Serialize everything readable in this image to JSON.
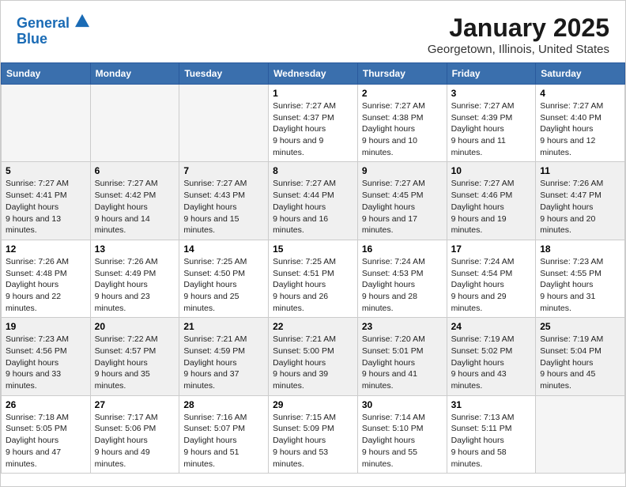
{
  "logo": {
    "line1": "General",
    "line2": "Blue"
  },
  "title": "January 2025",
  "location": "Georgetown, Illinois, United States",
  "weekdays": [
    "Sunday",
    "Monday",
    "Tuesday",
    "Wednesday",
    "Thursday",
    "Friday",
    "Saturday"
  ],
  "weeks": [
    [
      {
        "day": "",
        "sunrise": "",
        "sunset": "",
        "daylight": ""
      },
      {
        "day": "",
        "sunrise": "",
        "sunset": "",
        "daylight": ""
      },
      {
        "day": "",
        "sunrise": "",
        "sunset": "",
        "daylight": ""
      },
      {
        "day": "1",
        "sunrise": "7:27 AM",
        "sunset": "4:37 PM",
        "daylight": "9 hours and 9 minutes."
      },
      {
        "day": "2",
        "sunrise": "7:27 AM",
        "sunset": "4:38 PM",
        "daylight": "9 hours and 10 minutes."
      },
      {
        "day": "3",
        "sunrise": "7:27 AM",
        "sunset": "4:39 PM",
        "daylight": "9 hours and 11 minutes."
      },
      {
        "day": "4",
        "sunrise": "7:27 AM",
        "sunset": "4:40 PM",
        "daylight": "9 hours and 12 minutes."
      }
    ],
    [
      {
        "day": "5",
        "sunrise": "7:27 AM",
        "sunset": "4:41 PM",
        "daylight": "9 hours and 13 minutes."
      },
      {
        "day": "6",
        "sunrise": "7:27 AM",
        "sunset": "4:42 PM",
        "daylight": "9 hours and 14 minutes."
      },
      {
        "day": "7",
        "sunrise": "7:27 AM",
        "sunset": "4:43 PM",
        "daylight": "9 hours and 15 minutes."
      },
      {
        "day": "8",
        "sunrise": "7:27 AM",
        "sunset": "4:44 PM",
        "daylight": "9 hours and 16 minutes."
      },
      {
        "day": "9",
        "sunrise": "7:27 AM",
        "sunset": "4:45 PM",
        "daylight": "9 hours and 17 minutes."
      },
      {
        "day": "10",
        "sunrise": "7:27 AM",
        "sunset": "4:46 PM",
        "daylight": "9 hours and 19 minutes."
      },
      {
        "day": "11",
        "sunrise": "7:26 AM",
        "sunset": "4:47 PM",
        "daylight": "9 hours and 20 minutes."
      }
    ],
    [
      {
        "day": "12",
        "sunrise": "7:26 AM",
        "sunset": "4:48 PM",
        "daylight": "9 hours and 22 minutes."
      },
      {
        "day": "13",
        "sunrise": "7:26 AM",
        "sunset": "4:49 PM",
        "daylight": "9 hours and 23 minutes."
      },
      {
        "day": "14",
        "sunrise": "7:25 AM",
        "sunset": "4:50 PM",
        "daylight": "9 hours and 25 minutes."
      },
      {
        "day": "15",
        "sunrise": "7:25 AM",
        "sunset": "4:51 PM",
        "daylight": "9 hours and 26 minutes."
      },
      {
        "day": "16",
        "sunrise": "7:24 AM",
        "sunset": "4:53 PM",
        "daylight": "9 hours and 28 minutes."
      },
      {
        "day": "17",
        "sunrise": "7:24 AM",
        "sunset": "4:54 PM",
        "daylight": "9 hours and 29 minutes."
      },
      {
        "day": "18",
        "sunrise": "7:23 AM",
        "sunset": "4:55 PM",
        "daylight": "9 hours and 31 minutes."
      }
    ],
    [
      {
        "day": "19",
        "sunrise": "7:23 AM",
        "sunset": "4:56 PM",
        "daylight": "9 hours and 33 minutes."
      },
      {
        "day": "20",
        "sunrise": "7:22 AM",
        "sunset": "4:57 PM",
        "daylight": "9 hours and 35 minutes."
      },
      {
        "day": "21",
        "sunrise": "7:21 AM",
        "sunset": "4:59 PM",
        "daylight": "9 hours and 37 minutes."
      },
      {
        "day": "22",
        "sunrise": "7:21 AM",
        "sunset": "5:00 PM",
        "daylight": "9 hours and 39 minutes."
      },
      {
        "day": "23",
        "sunrise": "7:20 AM",
        "sunset": "5:01 PM",
        "daylight": "9 hours and 41 minutes."
      },
      {
        "day": "24",
        "sunrise": "7:19 AM",
        "sunset": "5:02 PM",
        "daylight": "9 hours and 43 minutes."
      },
      {
        "day": "25",
        "sunrise": "7:19 AM",
        "sunset": "5:04 PM",
        "daylight": "9 hours and 45 minutes."
      }
    ],
    [
      {
        "day": "26",
        "sunrise": "7:18 AM",
        "sunset": "5:05 PM",
        "daylight": "9 hours and 47 minutes."
      },
      {
        "day": "27",
        "sunrise": "7:17 AM",
        "sunset": "5:06 PM",
        "daylight": "9 hours and 49 minutes."
      },
      {
        "day": "28",
        "sunrise": "7:16 AM",
        "sunset": "5:07 PM",
        "daylight": "9 hours and 51 minutes."
      },
      {
        "day": "29",
        "sunrise": "7:15 AM",
        "sunset": "5:09 PM",
        "daylight": "9 hours and 53 minutes."
      },
      {
        "day": "30",
        "sunrise": "7:14 AM",
        "sunset": "5:10 PM",
        "daylight": "9 hours and 55 minutes."
      },
      {
        "day": "31",
        "sunrise": "7:13 AM",
        "sunset": "5:11 PM",
        "daylight": "9 hours and 58 minutes."
      },
      {
        "day": "",
        "sunrise": "",
        "sunset": "",
        "daylight": ""
      }
    ]
  ]
}
